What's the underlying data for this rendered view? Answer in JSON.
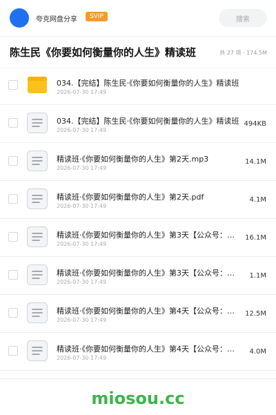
{
  "header": {
    "username": "夸克网盘分享",
    "badge": "SVIP",
    "search_placeholder": "搜索"
  },
  "folder": {
    "title": "陈生民《你要如何衡量你的人生》精读班",
    "summary": "共 27 项 · 174.5M"
  },
  "files": [
    {
      "icon": "folder-icon",
      "name": "034.【完结】陈生民·《你要如何衡量你的人生》精读班",
      "date": "2026-07-30 17:49",
      "size": ""
    },
    {
      "icon": "document-icon",
      "name": "034.【完结】陈生民·《你要如何衡量你的人生》精读班",
      "date": "2026-07-30 17:49",
      "size": "494KB"
    },
    {
      "icon": "document-icon",
      "name": "精读班·《你要如何衡量你的人生》第2天.mp3",
      "date": "2026-07-30 17:49",
      "size": "14.1M"
    },
    {
      "icon": "document-icon",
      "name": "精读班·《你要如何衡量你的人生》第2天.pdf",
      "date": "2026-07-30 17:49",
      "size": "4.1M"
    },
    {
      "icon": "document-icon",
      "name": "精读班·《你要如何衡量你的人生》第3天【公众号：密…",
      "date": "2026-07-30 17:49",
      "size": "16.1M"
    },
    {
      "icon": "document-icon",
      "name": "精读班·《你要如何衡量你的人生》第3天【公众号：密…",
      "date": "2026-07-30 17:49",
      "size": "1.1M"
    },
    {
      "icon": "document-icon",
      "name": "精读班·《你要如何衡量你的人生》第4天【公众号：密…",
      "date": "2026-07-30 17:49",
      "size": "12.5M"
    },
    {
      "icon": "document-icon",
      "name": "精读班·《你要如何衡量你的人生》第4天【公众号：密…",
      "date": "2026-07-30 17:49",
      "size": "4.0M"
    }
  ],
  "footer": {
    "brand": "miosou.cc"
  },
  "colors": {
    "avatar": "#1f6ff0",
    "badge": "#f59b2e",
    "brand": "#3cb54a",
    "folder": "#fcc21b"
  }
}
